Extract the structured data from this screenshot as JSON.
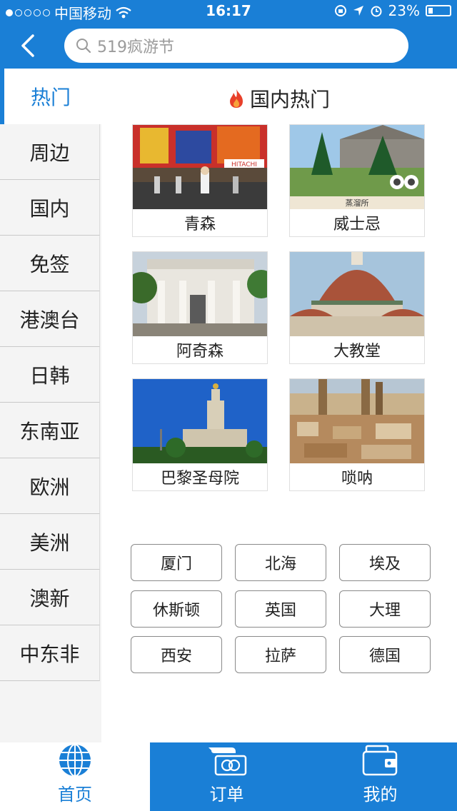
{
  "status_bar": {
    "carrier": "中国移动",
    "time": "16:17",
    "battery": "23%",
    "battery_level": 0.23
  },
  "search": {
    "placeholder": "519疯游节"
  },
  "sidebar": {
    "active": "热门",
    "items": [
      "周边",
      "国内",
      "免签",
      "港澳台",
      "日韩",
      "东南亚",
      "欧洲",
      "美洲",
      "澳新",
      "中东非"
    ]
  },
  "section": {
    "title": "国内热门",
    "icon": "flame-icon"
  },
  "cards": [
    {
      "label": "青森",
      "caption": "HITACHI"
    },
    {
      "label": "威士忌",
      "caption": "蒸溜所"
    },
    {
      "label": "阿奇森"
    },
    {
      "label": "大教堂"
    },
    {
      "label": "巴黎圣母院"
    },
    {
      "label": "唢呐"
    }
  ],
  "tags": [
    "厦门",
    "北海",
    "埃及",
    "休斯顿",
    "英国",
    "大理",
    "西安",
    "拉萨",
    "德国"
  ],
  "tabbar": {
    "home": "首页",
    "orders": "订单",
    "mine": "我的"
  },
  "colors": {
    "accent": "#1a7fd6",
    "flame": "#e8402a"
  }
}
